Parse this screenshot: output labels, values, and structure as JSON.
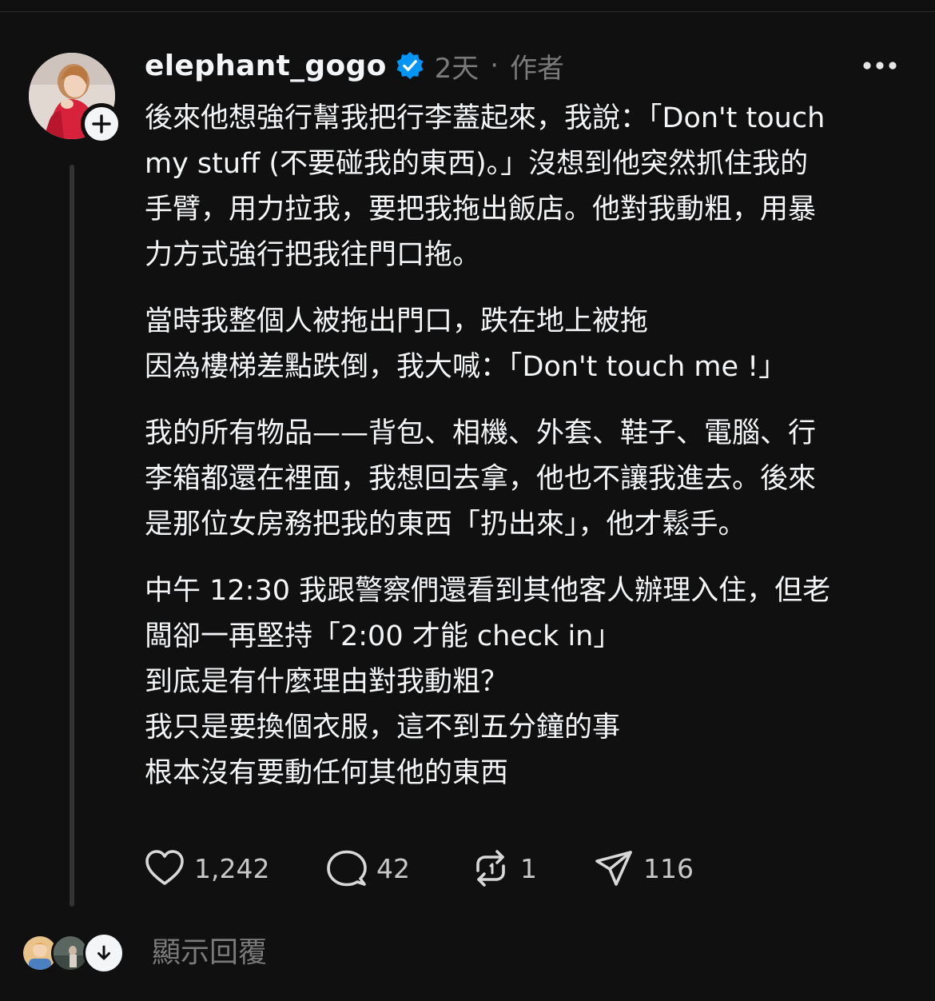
{
  "post": {
    "username": "elephant_gogo",
    "time": "2天",
    "separator": "·",
    "role": "作者",
    "paragraphs": [
      [
        "後來他想強行幫我把行李蓋起來，我說：「Don't touch",
        "my stuff (不要碰我的東西)。」沒想到他突然抓住我的",
        "手臂，用力拉我，要把我拖出飯店。他對我動粗，用暴",
        "力方式強行把我往門口拖。"
      ],
      [
        "當時我整個人被拖出門口，跌在地上被拖",
        "因為樓梯差點跌倒，我大喊：「Don't touch me !」"
      ],
      [
        "我的所有物品——背包、相機、外套、鞋子、電腦、行",
        "李箱都還在裡面，我想回去拿，他也不讓我進去。後來",
        "是那位女房務把我的東西「扔出來」，他才鬆手。"
      ],
      [
        "中午 12:30 我跟警察們還看到其他客人辦理入住，但老",
        "闆卻一再堅持「2:00 才能 check in」",
        "到底是有什麼理由對我動粗？",
        "我只是要換個衣服，這不到五分鐘的事",
        "根本沒有要動任何其他的東西"
      ]
    ]
  },
  "actions": {
    "likes": "1,242",
    "replies": "42",
    "reposts": "1",
    "shares": "116"
  },
  "footer": {
    "show_replies": "顯示回覆"
  },
  "icons": [
    "plus-icon",
    "verified-badge-icon",
    "more-icon",
    "heart-icon",
    "comment-icon",
    "repost-icon",
    "share-icon",
    "arrow-down-icon"
  ],
  "colors": {
    "background": "#101010",
    "text": "#f3f5f7",
    "muted": "#7a7a7a",
    "verified": "#0095f6"
  }
}
